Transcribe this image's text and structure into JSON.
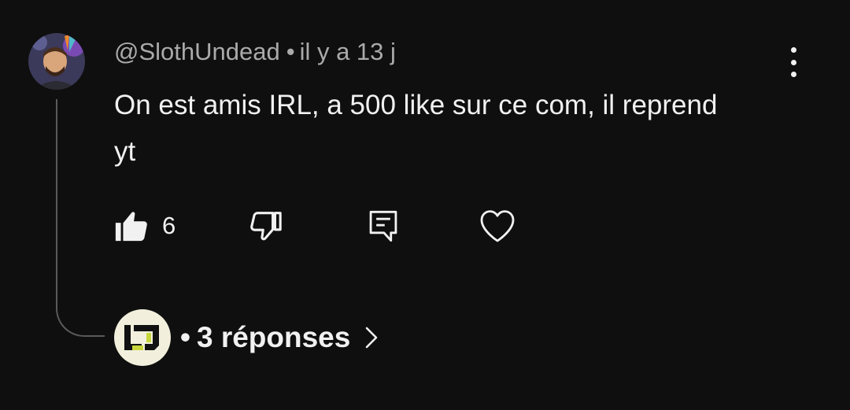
{
  "comment": {
    "author": "@SlothUndead",
    "separator": "•",
    "time_ago": "il y a 13 j",
    "text": "On est amis IRL, a 500 like sur ce com, il reprend yt",
    "avatar_icon": "user-avatar-photo",
    "menu_icon": "more-vertical-icon"
  },
  "actions": {
    "like_icon": "thumb-up-filled-icon",
    "like_count": "6",
    "dislike_icon": "thumb-down-icon",
    "reply_icon": "reply-comment-icon",
    "heart_icon": "heart-outline-icon"
  },
  "replies": {
    "separator": "•",
    "label": "3 réponses",
    "avatar_icon": "channel-logo-avatar",
    "chevron_icon": "chevron-right-icon"
  },
  "colors": {
    "background": "#0f0f0f",
    "text": "#f1f1f1",
    "secondary_text": "#aaaaaa",
    "thread_line": "#5a5a5a",
    "reply_avatar_bg": "#f2f0dc",
    "reply_logo_accent": "#c7d63a"
  }
}
